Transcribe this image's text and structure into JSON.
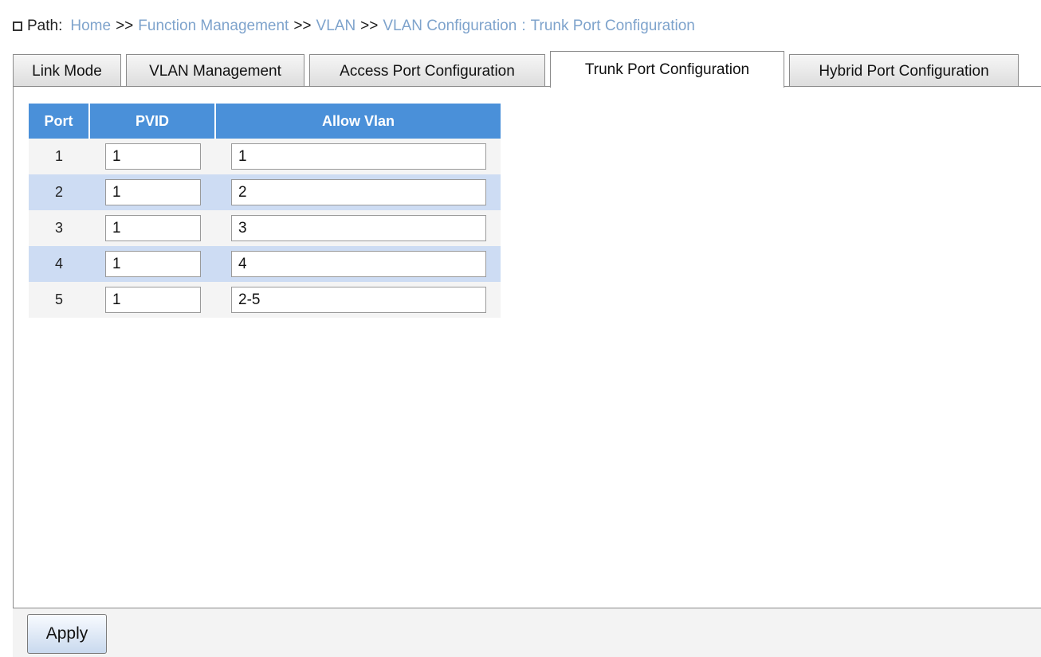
{
  "path": {
    "label": "Path:",
    "crumbs": [
      "Home",
      "Function Management",
      "VLAN",
      "VLAN Configuration"
    ],
    "separator": ">>",
    "colon": ":",
    "current": "Trunk Port Configuration"
  },
  "tabs": [
    {
      "label": "Link Mode"
    },
    {
      "label": "VLAN Management"
    },
    {
      "label": "Access Port Configuration"
    },
    {
      "label": "Trunk Port Configuration",
      "active": true
    },
    {
      "label": "Hybrid Port Configuration"
    }
  ],
  "table": {
    "headers": {
      "port": "Port",
      "pvid": "PVID",
      "allow_vlan": "Allow Vlan"
    },
    "rows": [
      {
        "port": "1",
        "pvid": "1",
        "allow_vlan": "1"
      },
      {
        "port": "2",
        "pvid": "1",
        "allow_vlan": "2"
      },
      {
        "port": "3",
        "pvid": "1",
        "allow_vlan": "3"
      },
      {
        "port": "4",
        "pvid": "1",
        "allow_vlan": "4"
      },
      {
        "port": "5",
        "pvid": "1",
        "allow_vlan": "2-5"
      }
    ]
  },
  "footer": {
    "apply_label": "Apply"
  },
  "colors": {
    "header_blue": "#4a90d9",
    "row_alt": "#cddcf3",
    "link": "#7ea3cc"
  }
}
